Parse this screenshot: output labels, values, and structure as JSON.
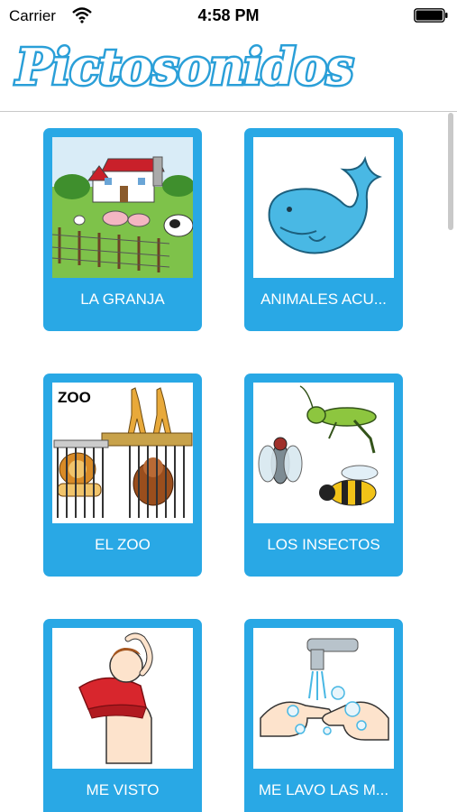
{
  "status_bar": {
    "carrier": "Carrier",
    "time": "4:58 PM"
  },
  "header": {
    "title": "Pictosonidos"
  },
  "cards": [
    {
      "label": "LA GRANJA",
      "icon": "farm-icon"
    },
    {
      "label": "ANIMALES ACU...",
      "icon": "whale-icon"
    },
    {
      "label": "EL ZOO",
      "icon": "zoo-icon",
      "caption": "ZOO"
    },
    {
      "label": "LOS INSECTOS",
      "icon": "insects-icon"
    },
    {
      "label": "ME VISTO",
      "icon": "dressing-icon"
    },
    {
      "label": "ME LAVO LAS M...",
      "icon": "hand-washing-icon"
    }
  ],
  "colors": {
    "accent": "#29a8e5",
    "logo": "#2a9fd8"
  }
}
